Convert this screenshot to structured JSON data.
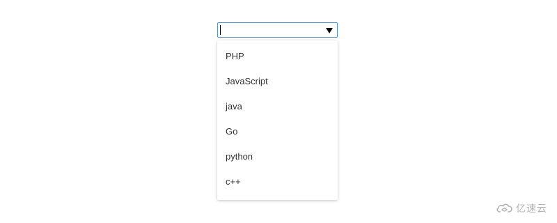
{
  "combobox": {
    "value": "",
    "toggle_icon": "triangle-down-icon",
    "border_color": "#4d8fe0"
  },
  "dropdown": {
    "options": [
      {
        "label": "PHP"
      },
      {
        "label": "JavaScript"
      },
      {
        "label": "java"
      },
      {
        "label": "Go"
      },
      {
        "label": "python"
      },
      {
        "label": "c++"
      }
    ]
  },
  "watermark": {
    "text": "亿速云",
    "icon": "cloud-logo-icon",
    "color": "#b4b4b4"
  }
}
